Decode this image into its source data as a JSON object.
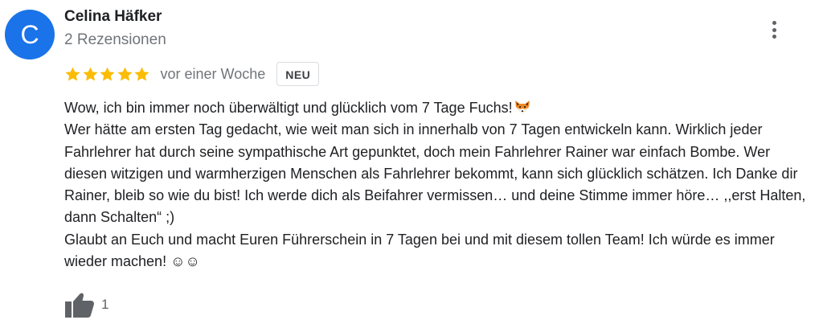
{
  "author": {
    "initial": "C",
    "name": "Celina Häfker",
    "reviews": "2 Rezensionen",
    "avatar_color": "#1a73e8"
  },
  "rating": {
    "stars": 5,
    "star_color": "#fbbc04",
    "date": "vor einer Woche",
    "badge": "NEU"
  },
  "review": {
    "line1": "Wow, ich bin immer noch überwältigt und glücklich vom 7 Tage Fuchs!",
    "line1_icon": "fox-face-icon",
    "paragraph2": "Wer hätte am ersten Tag gedacht, wie weit man sich in innerhalb von 7 Tagen entwickeln kann. Wirklich jeder Fahrlehrer hat durch seine sympathische Art gepunktet, doch mein Fahrlehrer Rainer war einfach Bombe. Wer diesen witzigen und warmherzigen Menschen als Fahrlehrer bekommt, kann sich glücklich schätzen. Ich Danke dir Rainer, bleib so wie du bist! Ich werde dich als Beifahrer vermissen… und deine Stimme immer höre… ,,erst Halten, dann Schalten“ ;)",
    "paragraph3": "Glaubt an Euch und macht Euren Führerschein in 7 Tagen bei und mit diesem tollen Team! Ich würde es immer wieder machen! ☺☺"
  },
  "actions": {
    "more_icon": "more-vert-icon",
    "like_icon": "thumbs-up-icon",
    "like_count": "1"
  }
}
